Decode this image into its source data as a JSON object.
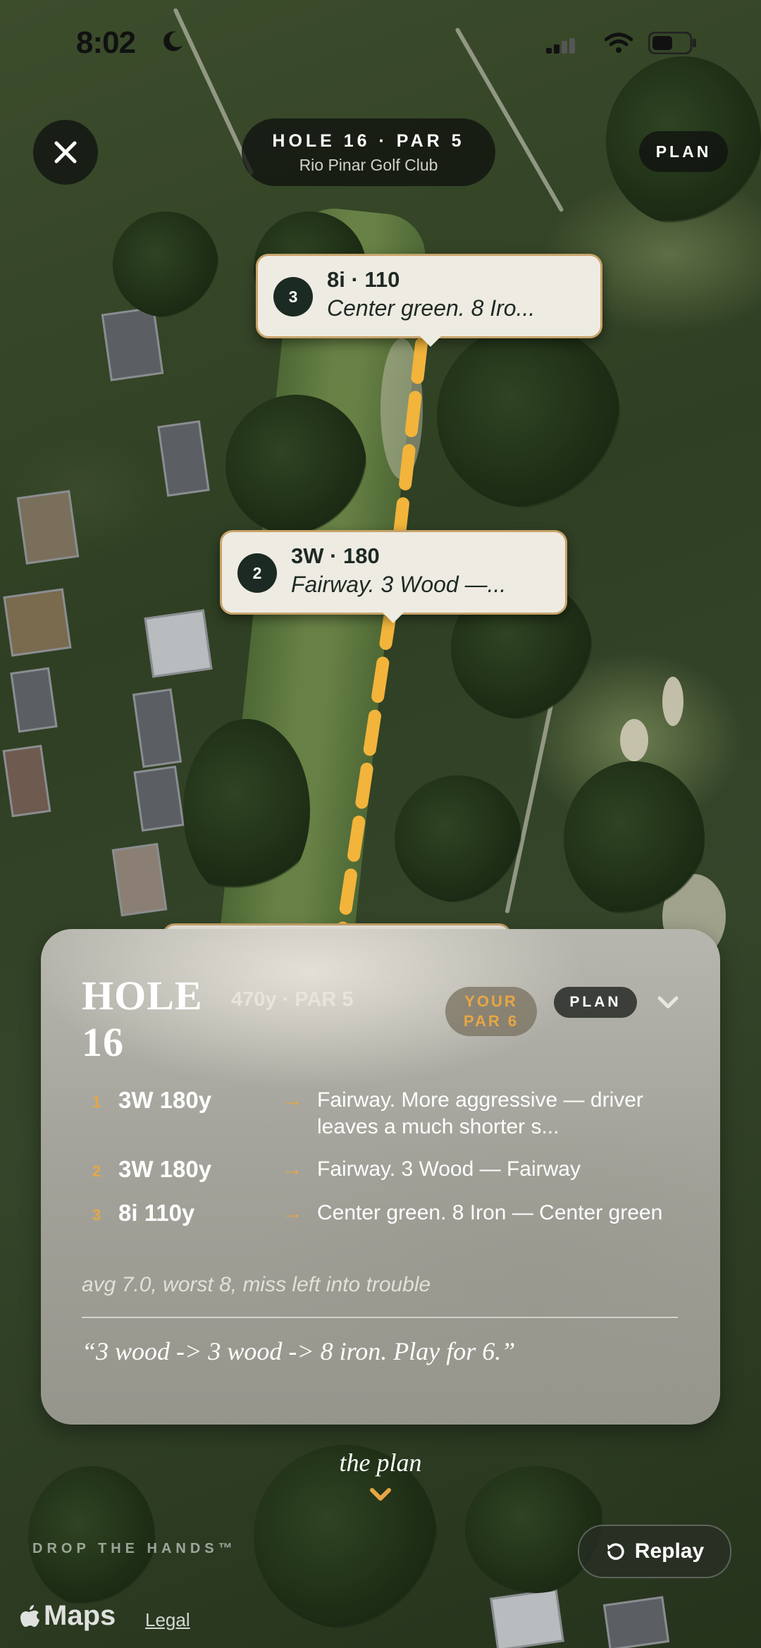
{
  "status_bar": {
    "time": "8:02"
  },
  "header": {
    "title": "HOLE 16 · PAR 5",
    "course": "Rio Pinar Golf Club",
    "plan_label": "PLAN"
  },
  "callouts": [
    {
      "number": "3",
      "club": "8i · 110",
      "description": "Center green. 8 Iro..."
    },
    {
      "number": "2",
      "club": "3W · 180",
      "description": "Fairway. 3 Wood —..."
    }
  ],
  "card": {
    "hole_label": "HOLE 16",
    "meta": "470y · PAR 5",
    "your_par_line1": "YOUR",
    "your_par_line2": "PAR 6",
    "plan_label": "PLAN",
    "shots": [
      {
        "index": "1",
        "club": "3W 180y",
        "description": "Fairway. More aggressive — driver leaves a much shorter s..."
      },
      {
        "index": "2",
        "club": "3W 180y",
        "description": "Fairway. 3 Wood — Fairway"
      },
      {
        "index": "3",
        "club": "8i 110y",
        "description": "Center green. 8 Iron — Center green"
      }
    ],
    "stats": "avg 7.0, worst 8, miss left into trouble",
    "quote": "“3 wood -> 3 wood -> 8 iron. Play for 6.”"
  },
  "footer": {
    "the_plan": "the plan",
    "brand": "DROP THE HANDS™",
    "replay": "Replay",
    "maps": "Maps",
    "legal": "Legal"
  },
  "colors": {
    "accent": "#e7a645",
    "callout_bg": "#eeebe2",
    "callout_border": "#c7a36a",
    "badge_dark": "#1b2a22"
  }
}
